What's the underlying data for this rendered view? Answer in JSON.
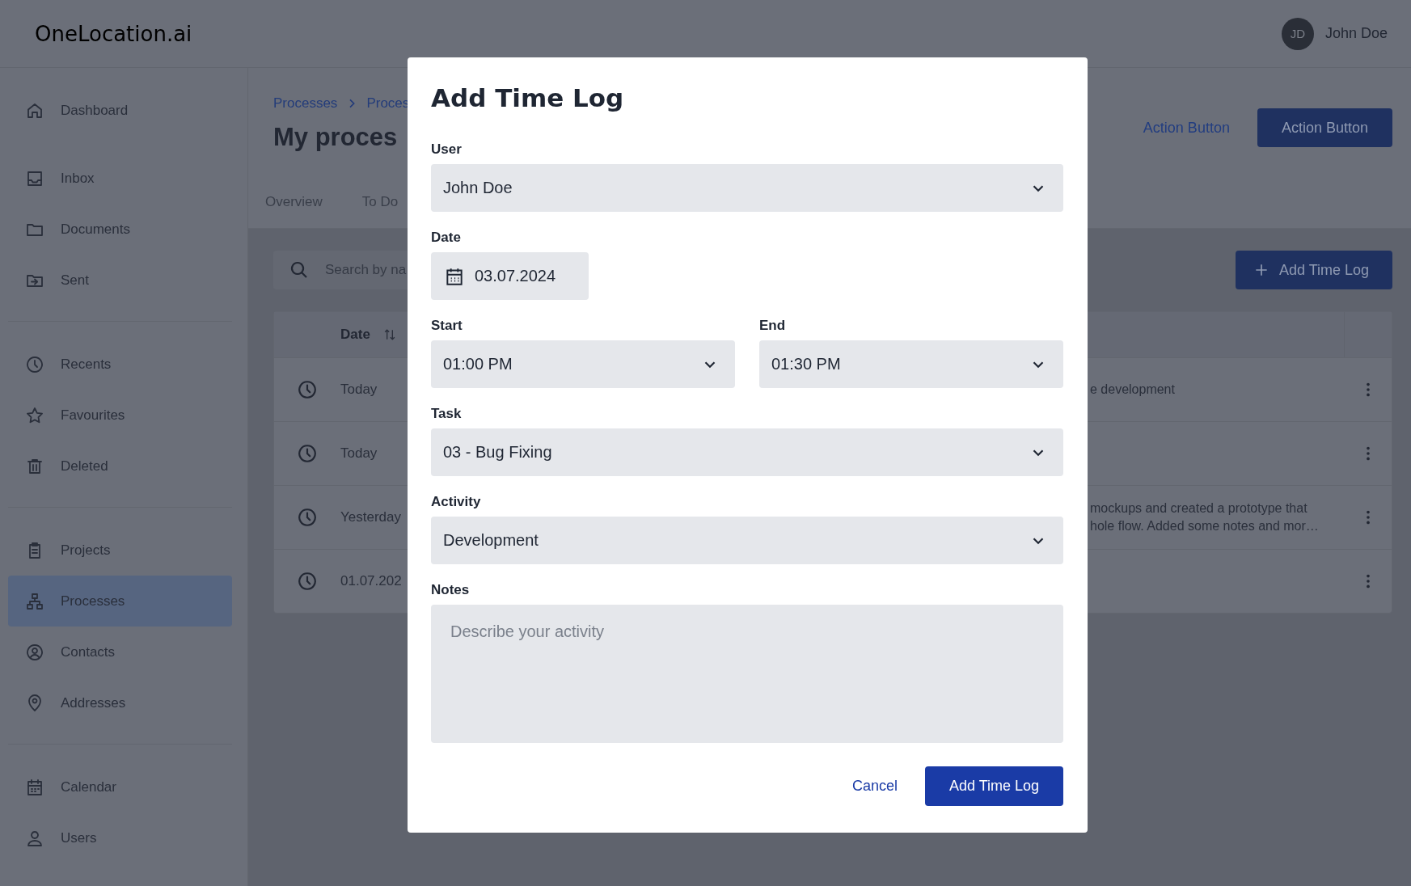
{
  "app": {
    "logo": "OneLocation.ai",
    "user": {
      "initials": "JD",
      "name": "John Doe"
    }
  },
  "sidebar": {
    "groups": [
      [
        {
          "label": "Dashboard",
          "selected": false
        },
        {
          "label": "Inbox",
          "selected": false
        },
        {
          "label": "Documents",
          "selected": false
        },
        {
          "label": "Sent",
          "selected": false
        }
      ],
      [
        {
          "label": "Recents",
          "selected": false
        },
        {
          "label": "Favourites",
          "selected": false
        },
        {
          "label": "Deleted",
          "selected": false
        }
      ],
      [
        {
          "label": "Projects",
          "selected": false
        },
        {
          "label": "Processes",
          "selected": true
        },
        {
          "label": "Contacts",
          "selected": false
        },
        {
          "label": "Addresses",
          "selected": false
        }
      ],
      [
        {
          "label": "Calendar",
          "selected": false
        },
        {
          "label": "Users",
          "selected": false
        }
      ]
    ]
  },
  "page": {
    "breadcrumbs": [
      "Processes",
      "Proces"
    ],
    "title": "My proces",
    "actions": [
      {
        "kind": "link",
        "label": "Action Button"
      },
      {
        "kind": "primary",
        "label": "Action Button"
      }
    ],
    "tabs": [
      "Overview",
      "To Do"
    ]
  },
  "toolbar": {
    "search": {
      "placeholder": "Search by na"
    },
    "add_button": "Add Time Log"
  },
  "table": {
    "columns": [
      "Date"
    ],
    "rows": [
      {
        "date": "Today",
        "notes": [
          "e development"
        ]
      },
      {
        "date": "Today",
        "notes": []
      },
      {
        "date": "Yesterday",
        "notes": [
          "mockups and created a prototype that",
          "hole flow. Added some notes and mor…"
        ]
      },
      {
        "date": "01.07.202",
        "notes": []
      }
    ]
  },
  "dialog": {
    "title": "Add Time Log",
    "fields": [
      {
        "kind": "select",
        "label": "User",
        "value": "John Doe"
      },
      {
        "kind": "date",
        "label": "Date",
        "value": "03.07.2024"
      },
      {
        "kind": "row",
        "fields": [
          {
            "kind": "select",
            "label": "Start",
            "value": "01:00 PM"
          },
          {
            "kind": "select",
            "label": "End",
            "value": "01:30 PM"
          }
        ]
      },
      {
        "kind": "select",
        "label": "Task",
        "value": "03 - Bug Fixing"
      },
      {
        "kind": "select",
        "label": "Activity",
        "value": "Development"
      },
      {
        "kind": "textarea",
        "label": "Notes",
        "placeholder": "Describe your activity"
      }
    ],
    "buttons": [
      {
        "kind": "link",
        "label": "Cancel"
      },
      {
        "kind": "primary",
        "label": "Add Time Log"
      }
    ]
  }
}
